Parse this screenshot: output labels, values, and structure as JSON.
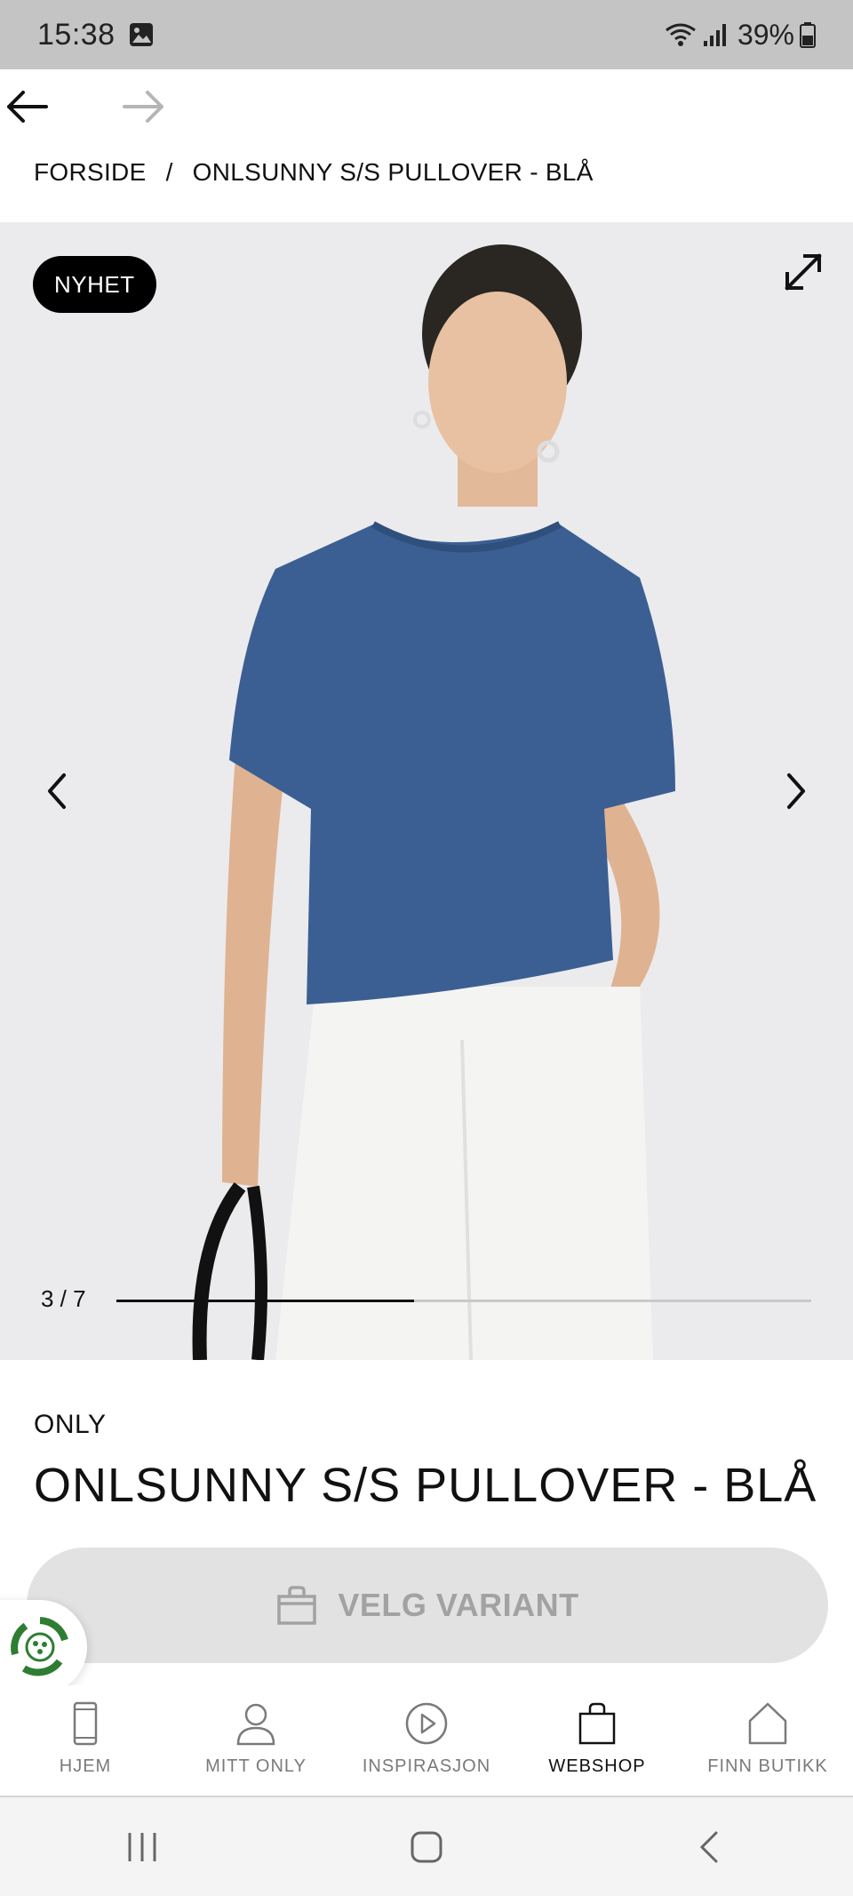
{
  "status_bar": {
    "time": "15:38",
    "battery": "39%",
    "icons": [
      "gallery-icon",
      "wifi-icon",
      "signal-icon",
      "battery-icon"
    ]
  },
  "browser_nav": {
    "icons": [
      "back-arrow-icon",
      "forward-arrow-icon"
    ]
  },
  "breadcrumb": {
    "home": "FORSIDE",
    "separator": "/",
    "current": "ONLSUNNY S/S PULLOVER - BLÅ"
  },
  "gallery": {
    "badge": "NYHET",
    "counter": "3 / 7",
    "current_image": 3,
    "total_images": 7,
    "icons": [
      "expand-icon",
      "chevron-left-icon",
      "chevron-right-icon"
    ]
  },
  "product": {
    "brand": "ONLY",
    "title": "ONLSUNNY S/S PULLOVER - BLÅ"
  },
  "cta": {
    "label": "VELG VARIANT",
    "icon": "shopping-bag-icon"
  },
  "bottom_nav": {
    "items": [
      {
        "label": "HJEM",
        "icon": "phone-icon",
        "active": false
      },
      {
        "label": "MITT ONLY",
        "icon": "person-icon",
        "active": false
      },
      {
        "label": "INSPIRASJON",
        "icon": "play-icon",
        "active": false
      },
      {
        "label": "WEBSHOP",
        "icon": "shopping-bag-icon",
        "active": true
      },
      {
        "label": "FINN BUTIKK",
        "icon": "store-icon",
        "active": false
      }
    ]
  },
  "colors": {
    "sweater": "#3b5f92",
    "accent": "#000000",
    "recycle_green": "#2e7d32"
  }
}
